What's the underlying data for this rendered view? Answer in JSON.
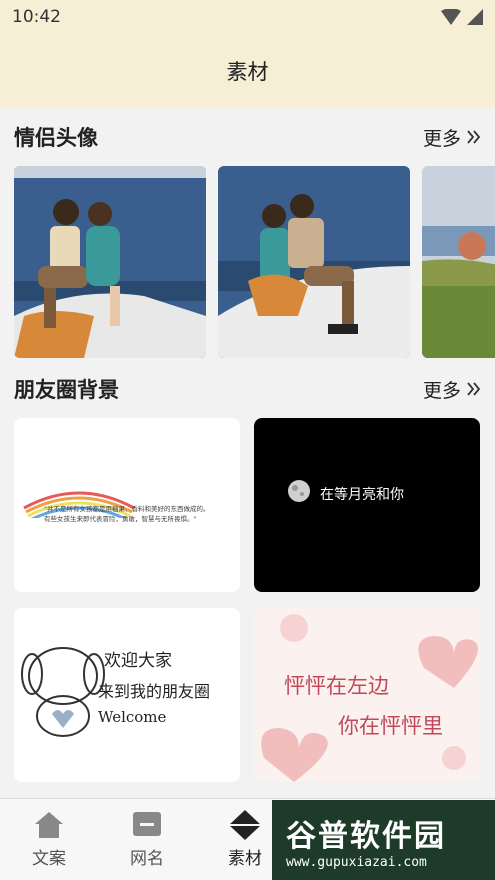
{
  "status": {
    "time": "10:42"
  },
  "header": {
    "title": "素材"
  },
  "section1": {
    "title": "情侣头像",
    "more": "更多"
  },
  "section2": {
    "title": "朋友圈背景",
    "more": "更多"
  },
  "grid": {
    "card1_text": "\"并不是所有女孩都是用糖果、香料和美好的东西做成的。有些女孩生来即代表冒险，勇敢，智慧与无所畏惧。\"",
    "card2_text": "在等月亮和你",
    "card3_line1": "欢迎大家",
    "card3_line2": "来到我的朋友圈",
    "card3_line3": "Welcome",
    "card4_line1": "怦怦在左边",
    "card4_line2": "你在怦怦里"
  },
  "tabs": [
    {
      "label": "文案"
    },
    {
      "label": "网名"
    },
    {
      "label": "素材"
    }
  ],
  "watermark": {
    "line1": "谷普软件园",
    "line2": "www.gupuxiazai.com"
  }
}
